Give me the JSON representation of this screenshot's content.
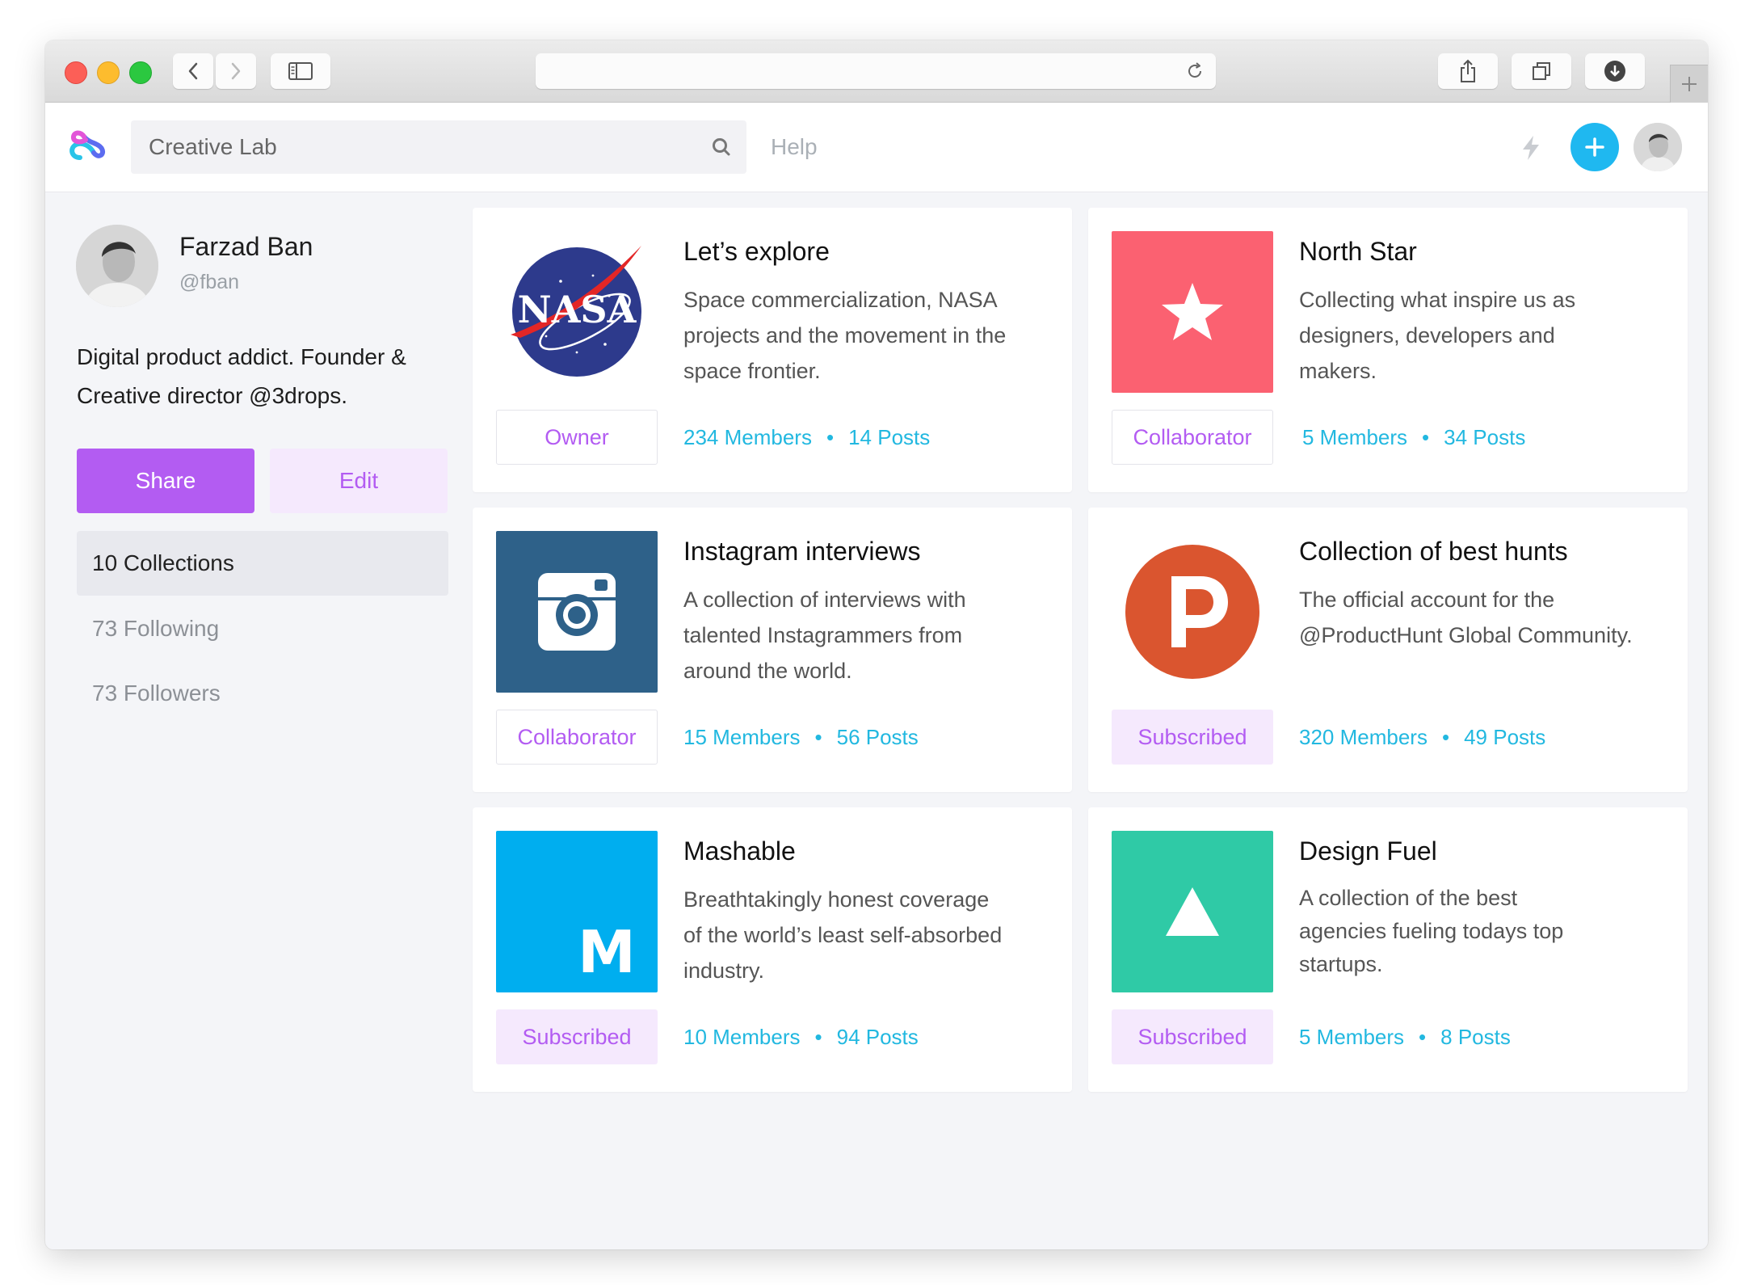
{
  "browser": {
    "address_value": ""
  },
  "appbar": {
    "search_value": "Creative Lab",
    "help_label": "Help"
  },
  "profile": {
    "name": "Farzad Ban",
    "handle": "@fban",
    "bio_line1": "Digital product addict. Founder &",
    "bio_line2": "Creative director @3drops.",
    "share_label": "Share",
    "edit_label": "Edit"
  },
  "sidebar": {
    "items": [
      {
        "label": "10 Collections",
        "active": true
      },
      {
        "label": "73 Following",
        "active": false
      },
      {
        "label": "73 Followers",
        "active": false
      }
    ]
  },
  "collections": [
    {
      "title": "Let’s explore",
      "desc_lines": [
        "Space commercialization, NASA",
        "projects and the movement in the",
        "space frontier."
      ],
      "role": "Owner",
      "members": "234 Members",
      "posts": "14 Posts",
      "thumb": "nasa-logo",
      "logo_text": "NASA",
      "color": "#2d3a8c"
    },
    {
      "title": "North Star",
      "desc_lines": [
        "Collecting what inspire us as",
        "designers, developers and",
        "makers."
      ],
      "role": "Collaborator",
      "members": "5 Members",
      "posts": "34 Posts",
      "thumb": "star-icon",
      "color": "#fb6171"
    },
    {
      "title": "Instagram interviews",
      "desc_lines": [
        "A collection of interviews with",
        "talented Instagrammers from",
        "around the world."
      ],
      "role": "Collaborator",
      "members": "15 Members",
      "posts": "56 Posts",
      "thumb": "instagram-icon",
      "color": "#2e6189"
    },
    {
      "title": "Collection of best hunts",
      "desc_lines": [
        "The official account for the",
        "@ProductHunt Global Community."
      ],
      "role": "Subscribed",
      "members": "320 Members",
      "posts": "49 Posts",
      "thumb": "producthunt-icon",
      "color": "#da552f"
    },
    {
      "title": "Mashable",
      "desc_lines": [
        "Breathtakingly honest coverage",
        "of the world’s least self-absorbed",
        "industry."
      ],
      "role": "Subscribed",
      "members": "10 Members",
      "posts": "94 Posts",
      "thumb": "mashable-icon",
      "logo_text": "M",
      "color": "#00aeef"
    },
    {
      "title": "Design Fuel",
      "desc_lines": [
        "A collection of the best",
        "agencies fueling todays top",
        "startups."
      ],
      "role": "Subscribed",
      "members": "5 Members",
      "posts": "8 Posts",
      "thumb": "triangle-icon",
      "color": "#2fcaa6"
    }
  ],
  "colors": {
    "accent": "#b35cf2",
    "accent_soft": "#f5e9fd",
    "link": "#22b8e0",
    "add_button": "#1fb8f0"
  }
}
